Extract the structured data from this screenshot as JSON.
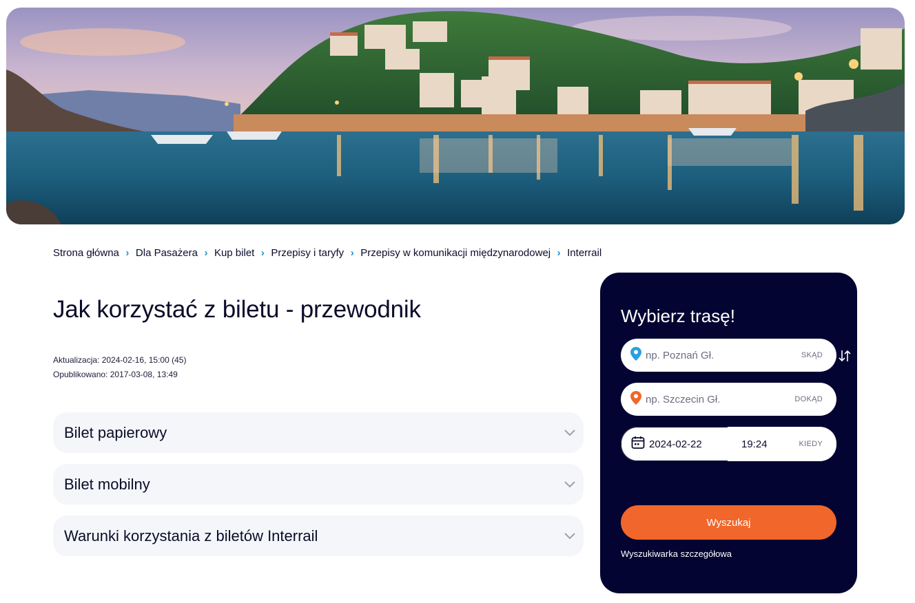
{
  "hero": {
    "image": "coastal-town-at-dusk"
  },
  "breadcrumb": {
    "items": [
      {
        "label": "Strona główna"
      },
      {
        "label": "Dla Pasażera"
      },
      {
        "label": "Kup bilet"
      },
      {
        "label": "Przepisy i taryfy"
      },
      {
        "label": "Przepisy w komunikacji międzynarodowej"
      },
      {
        "label": "Interrail"
      }
    ],
    "separator_icon": "chevron-right-icon",
    "separator_color": "#1f8fd6"
  },
  "page": {
    "title": "Jak korzystać z biletu - przewodnik",
    "updated": "Aktualizacja: 2024-02-16, 15:00 (45)",
    "published": "Opublikowano: 2017-03-08, 13:49"
  },
  "accordion": {
    "items": [
      {
        "label": "Bilet papierowy"
      },
      {
        "label": "Bilet mobilny"
      },
      {
        "label": "Warunki korzystania z biletów Interrail"
      }
    ],
    "chevron_icon": "chevron-down-icon"
  },
  "route": {
    "title": "Wybierz trasę!",
    "from": {
      "placeholder": "np. Poznań Gł.",
      "tag": "SKĄD",
      "icon": "location-pin-blue-icon"
    },
    "to": {
      "placeholder": "np. Szczecin Gł.",
      "tag": "DOKĄD",
      "icon": "location-pin-orange-icon"
    },
    "swap_icon": "swap-arrows-icon",
    "date": "2024-02-22",
    "time": "19:24",
    "when_tag": "KIEDY",
    "calendar_icon": "calendar-icon",
    "search_label": "Wyszukaj",
    "advanced_link": "Wyszukiwarka szczegółowa"
  },
  "colors": {
    "panel_bg": "#030431",
    "accent_orange": "#f1662a",
    "accent_blue": "#1f8fd6",
    "accordion_bg": "#f4f6f9",
    "text_dark": "#0b0c2a"
  }
}
